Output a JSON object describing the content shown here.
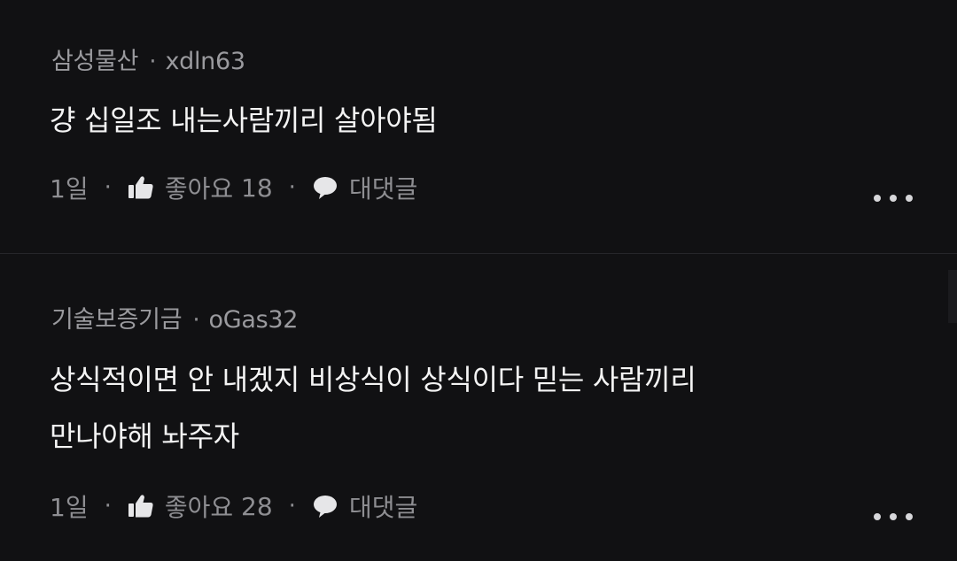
{
  "comments": [
    {
      "org": "삼성물산",
      "separator": "·",
      "username": "xdln63",
      "lines": [
        "걍 십일조 내는사람끼리 살아야됨"
      ],
      "time": "1일",
      "like_label": "좋아요",
      "like_count": "18",
      "reply_label": "대댓글"
    },
    {
      "org": "기술보증기금",
      "separator": "·",
      "username": "oGas32",
      "lines": [
        "상식적이면 안 내겠지 비상식이 상식이다 믿는 사람끼리",
        "만나야해 놔주자"
      ],
      "time": "1일",
      "like_label": "좋아요",
      "like_count": "28",
      "reply_label": "대댓글"
    }
  ],
  "meta_separator": "·",
  "icons": {
    "like": "thumbs-up-icon",
    "reply": "speech-bubble-icon",
    "more": "more-horizontal-icon"
  },
  "colors": {
    "background": "#111113",
    "body_text": "#f4f4f4",
    "secondary_text": "#9a9a9e"
  }
}
